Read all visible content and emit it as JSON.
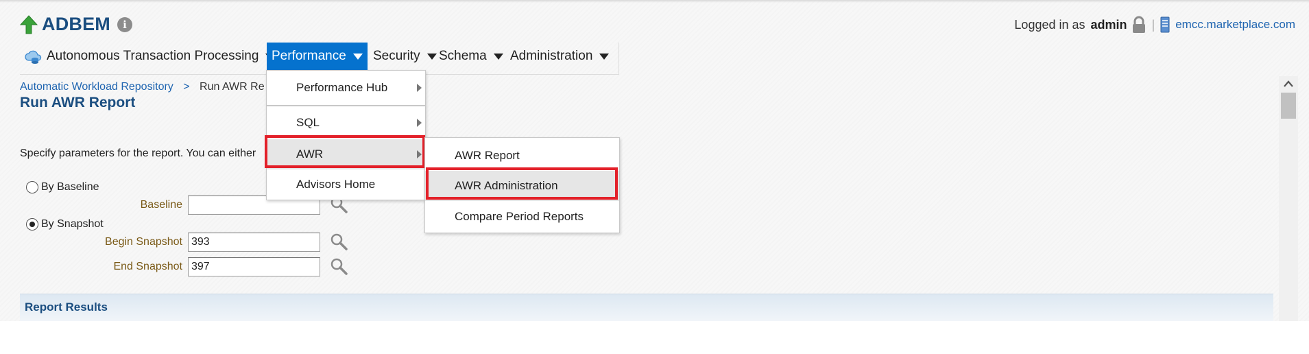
{
  "header": {
    "app_title": "ADBEM",
    "logged_in_prefix": "Logged in as",
    "username": "admin",
    "host": "emcc.marketplace.com"
  },
  "menubar": {
    "items": [
      {
        "label": "Autonomous Transaction Processing"
      },
      {
        "label": "Performance"
      },
      {
        "label": "Security"
      },
      {
        "label": "Schema"
      },
      {
        "label": "Administration"
      }
    ]
  },
  "performance_menu": {
    "items": [
      {
        "label": "Performance Hub"
      },
      {
        "label": "SQL"
      },
      {
        "label": "AWR"
      },
      {
        "label": "Advisors Home"
      }
    ]
  },
  "awr_submenu": {
    "items": [
      {
        "label": "AWR Report"
      },
      {
        "label": "AWR Administration"
      },
      {
        "label": "Compare Period Reports"
      }
    ]
  },
  "breadcrumb": {
    "link": "Automatic Workload Repository",
    "separator": ">",
    "current": "Run AWR Re"
  },
  "page": {
    "title": "Run AWR Report",
    "instructions": "Specify parameters for the report. You can either"
  },
  "form": {
    "by_baseline_label": "By Baseline",
    "baseline_label": "Baseline",
    "baseline_value": "",
    "by_snapshot_label": "By Snapshot",
    "begin_snapshot_label": "Begin Snapshot",
    "begin_snapshot_value": "393",
    "end_snapshot_label": "End Snapshot",
    "end_snapshot_value": "397",
    "selected_mode": "By Snapshot"
  },
  "results": {
    "header": "Report Results"
  },
  "colors": {
    "accent": "#0572ce",
    "title": "#1b4e80",
    "link": "#1e64b0",
    "highlight": "#e3212a",
    "field_label": "#7a5a17"
  }
}
